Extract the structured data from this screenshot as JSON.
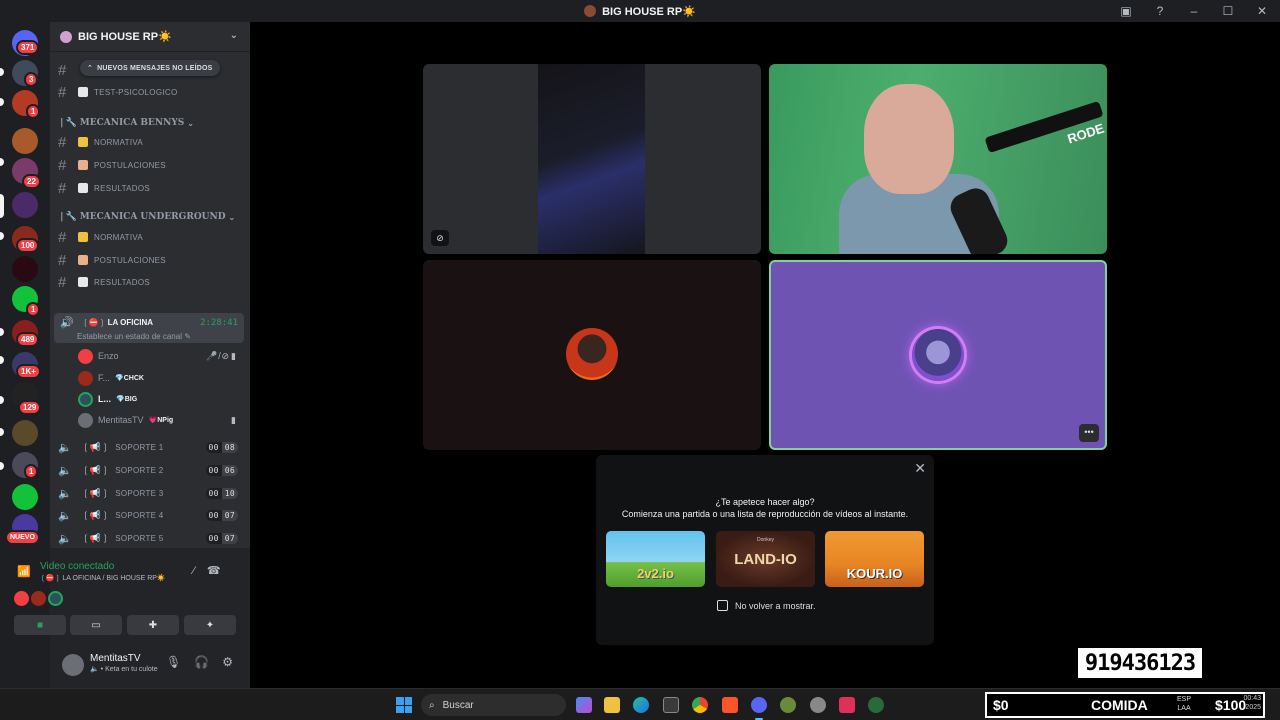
{
  "window": {
    "title": "BIG HOUSE RP☀️"
  },
  "rail": {
    "badges": [
      "371",
      "3",
      "1",
      "22",
      "100",
      "1",
      "489",
      "1K+",
      "129",
      "1"
    ],
    "new_label": "NUEVO"
  },
  "server": {
    "name": "BIG HOUSE RP☀️"
  },
  "unread_pill": "NUEVOS MENSAJES NO LEÍDOS",
  "channels_top": [
    {
      "name": "TEST-PSICOLOGICO"
    }
  ],
  "categories": [
    {
      "name": "MECANICA BENNYS",
      "channels": [
        {
          "name": "NORMATIVA"
        },
        {
          "name": "POSTULACIONES"
        },
        {
          "name": "RESULTADOS"
        }
      ]
    },
    {
      "name": "MECANICA UNDERGROUND",
      "channels": [
        {
          "name": "NORMATIVA"
        },
        {
          "name": "POSTULACIONES"
        },
        {
          "name": "RESULTADOS"
        }
      ]
    }
  ],
  "active_voice": {
    "name": "LA OFICINA",
    "status_hint": "Establece un estado de canal",
    "elapsed": "2:28:41",
    "users": [
      {
        "name": "Enzo",
        "tag": ""
      },
      {
        "name": "F...",
        "tag": "CHCK"
      },
      {
        "name": "L...",
        "tag": "BIG"
      },
      {
        "name": "MentitasTV",
        "tag": "NPig"
      }
    ]
  },
  "voice_channels": [
    {
      "name": "SOPORTE 1",
      "count": "00",
      "limit": "08"
    },
    {
      "name": "SOPORTE 2",
      "count": "00",
      "limit": "06"
    },
    {
      "name": "SOPORTE 3",
      "count": "00",
      "limit": "10"
    },
    {
      "name": "SOPORTE 4",
      "count": "00",
      "limit": "07"
    },
    {
      "name": "SOPORTE 5",
      "count": "00",
      "limit": "07"
    }
  ],
  "voice_panel": {
    "status": "Video conectado",
    "location": "LA OFICINA / BIG HOUSE RP☀️"
  },
  "user": {
    "name": "MentitasTV",
    "status": "Keta en tu culote"
  },
  "stage": {
    "tile2_brand": "RODE"
  },
  "activity_popup": {
    "question": "¿Te apetece hacer algo?",
    "description": "Comienza una partida o una lista de reproducción de vídeos al instante.",
    "games": [
      {
        "name": "2v2.io"
      },
      {
        "name": "LAND-IO",
        "overline": "Donkey"
      },
      {
        "name": "KOUR.IO"
      }
    ],
    "dont_show": "No volver a mostrar."
  },
  "overlay": {
    "phone_number": "919436123"
  },
  "taskbar": {
    "search_placeholder": "Buscar"
  },
  "hud": {
    "money_left": "$0",
    "label": "COMIDA",
    "lang_line1": "ESP",
    "lang_line2": "LAA",
    "money_right": "$100",
    "time": "00:43",
    "date": "2025"
  }
}
